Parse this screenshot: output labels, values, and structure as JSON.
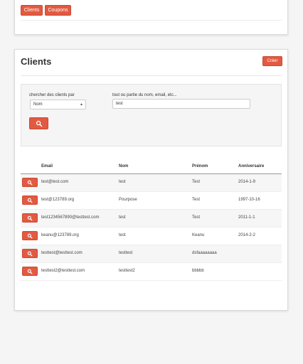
{
  "nav": {
    "clients_label": "Clients",
    "coupons_label": "Coupons"
  },
  "page": {
    "title": "Clients",
    "create_label": "Créer"
  },
  "search": {
    "filter_label": "chercher des clients par",
    "filter_value": "Nom",
    "query_label": "tout ou partie du nom, email, etc...",
    "query_value": "test"
  },
  "table": {
    "columns": [
      "Email",
      "Nom",
      "Prénom",
      "Anniversaire"
    ],
    "rows": [
      [
        "test@test.com",
        "test",
        "Test",
        "2014-1-9"
      ],
      [
        "test@123789.org",
        "Pourpose",
        "Test",
        "1997-10-16"
      ],
      [
        "test1234567890@testtest.com",
        "test",
        "Test",
        "2011-1-1"
      ],
      [
        "keanu@123789.org",
        "test",
        "Keanu",
        "2014-2-2"
      ],
      [
        "testtest@testtest.com",
        "testtest",
        "dsfaaaaaaaa",
        ""
      ],
      [
        "testtest2@testtest.com",
        "testtest2",
        "bbbbb",
        ""
      ]
    ]
  },
  "colors": {
    "accent": "#e25a41"
  }
}
